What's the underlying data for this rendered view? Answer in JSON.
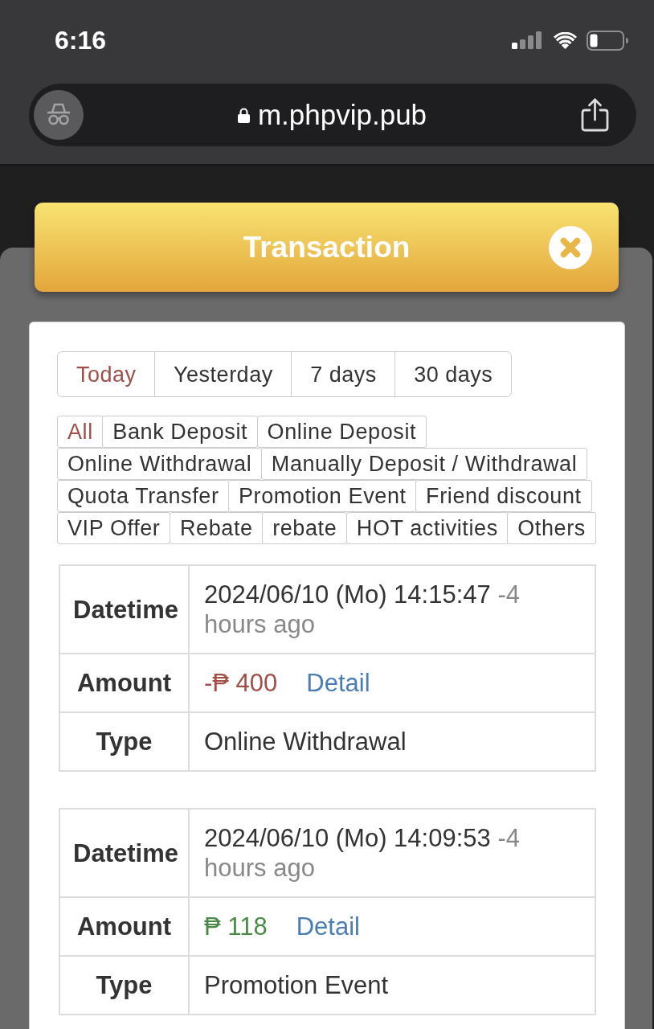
{
  "status_bar": {
    "time": "6:16"
  },
  "browser": {
    "url": "m.phpvip.pub"
  },
  "modal": {
    "title": "Transaction"
  },
  "date_tabs": [
    {
      "label": "Today",
      "selected": true
    },
    {
      "label": "Yesterday",
      "selected": false
    },
    {
      "label": "7 days",
      "selected": false
    },
    {
      "label": "30 days",
      "selected": false
    }
  ],
  "categories": [
    {
      "label": "All",
      "selected": true
    },
    {
      "label": "Bank Deposit",
      "selected": false
    },
    {
      "label": "Online Deposit",
      "selected": false
    },
    {
      "label": "Online Withdrawal",
      "selected": false
    },
    {
      "label": "Manually Deposit / Withdrawal",
      "selected": false
    },
    {
      "label": "Quota Transfer",
      "selected": false
    },
    {
      "label": "Promotion Event",
      "selected": false
    },
    {
      "label": "Friend discount",
      "selected": false
    },
    {
      "label": "VIP Offer",
      "selected": false
    },
    {
      "label": "Rebate",
      "selected": false
    },
    {
      "label": "rebate",
      "selected": false
    },
    {
      "label": "HOT activities",
      "selected": false
    },
    {
      "label": "Others",
      "selected": false
    }
  ],
  "transactions": [
    {
      "datetime": {
        "label": "Datetime",
        "value": "2024/06/10 (Mo) 14:15:47",
        "relative": "-4 hours ago"
      },
      "amount": {
        "label": "Amount",
        "value": "-₱ 400",
        "kind": "debit",
        "link": "Detail"
      },
      "type": {
        "label": "Type",
        "value": "Online Withdrawal"
      }
    },
    {
      "datetime": {
        "label": "Datetime",
        "value": "2024/06/10 (Mo) 14:09:53",
        "relative": "-4 hours ago"
      },
      "amount": {
        "label": "Amount",
        "value": "₱ 118",
        "kind": "credit",
        "link": "Detail"
      },
      "type": {
        "label": "Type",
        "value": "Promotion Event"
      }
    }
  ]
}
